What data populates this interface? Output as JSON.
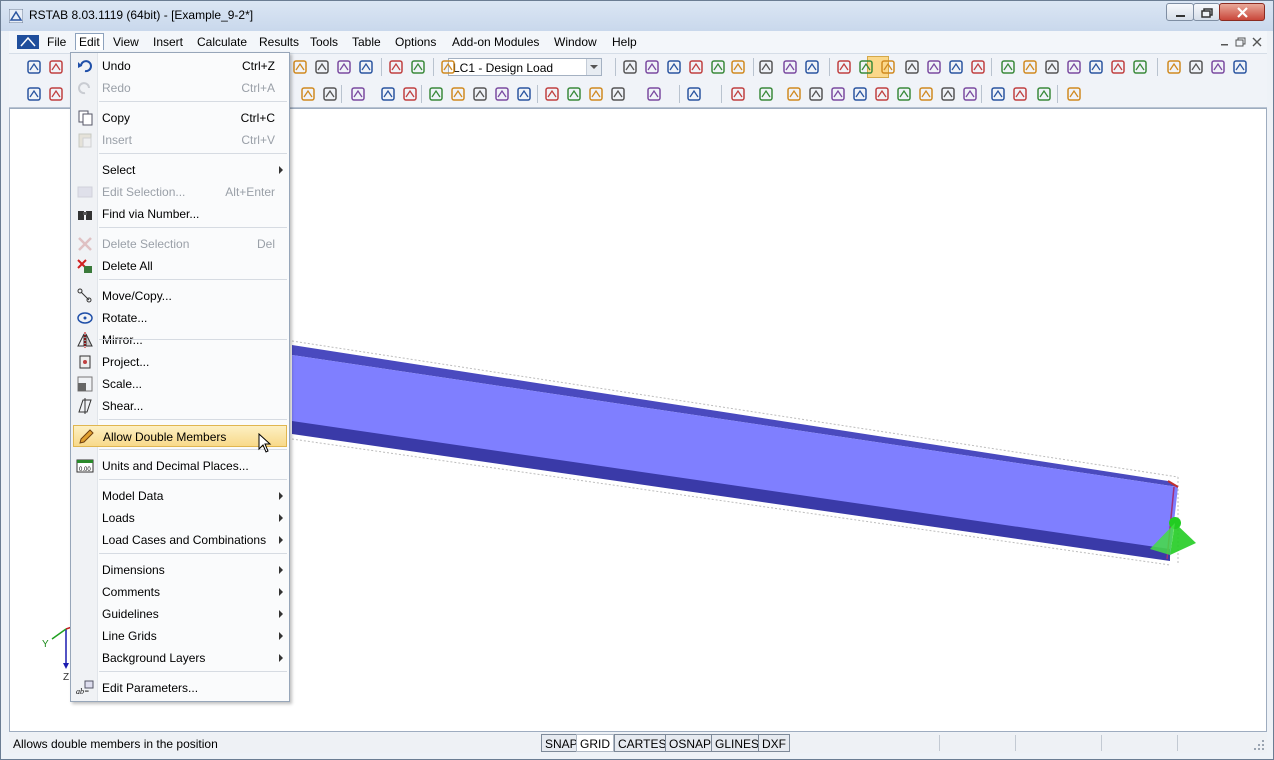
{
  "window": {
    "title": "RSTAB 8.03.1119 (64bit) - [Example_9-2*]"
  },
  "menubar": {
    "items": [
      "File",
      "Edit",
      "View",
      "Insert",
      "Calculate",
      "Results",
      "Tools",
      "Table",
      "Options",
      "Add-on Modules",
      "Window",
      "Help"
    ]
  },
  "toolbar": {
    "load_case": "LC1 - Design Load"
  },
  "edit_menu": {
    "items": [
      {
        "label": "Undo",
        "shortcut": "Ctrl+Z",
        "icon": "undo-icon"
      },
      {
        "label": "Redo",
        "shortcut": "Ctrl+A",
        "icon": "redo-icon"
      },
      {
        "label": "Copy",
        "shortcut": "Ctrl+C",
        "icon": "copy-icon"
      },
      {
        "label": "Insert",
        "shortcut": "Ctrl+V",
        "icon": "paste-icon"
      },
      {
        "label": "Select",
        "icon": "none"
      },
      {
        "label": "Edit Selection...",
        "shortcut": "Alt+Enter",
        "icon": "edit-selection-icon"
      },
      {
        "label": "Find via Number...",
        "icon": "binoculars-icon"
      },
      {
        "label": "Delete Selection",
        "shortcut": "Del",
        "icon": "delete-icon"
      },
      {
        "label": "Delete All",
        "icon": "delete-all-icon"
      },
      {
        "label": "Move/Copy...",
        "icon": "move-copy-icon"
      },
      {
        "label": "Rotate...",
        "icon": "rotate-icon"
      },
      {
        "label": "Mirror...",
        "icon": "mirror-icon"
      },
      {
        "label": "Project...",
        "icon": "project-icon"
      },
      {
        "label": "Scale...",
        "icon": "scale-icon"
      },
      {
        "label": "Shear...",
        "icon": "shear-icon"
      },
      {
        "label": "Allow Double Members",
        "icon": "pencil-icon"
      },
      {
        "label": "Units and Decimal Places...",
        "icon": "units-icon"
      },
      {
        "label": "Model Data",
        "icon": "none"
      },
      {
        "label": "Loads",
        "icon": "none"
      },
      {
        "label": "Load Cases and Combinations",
        "icon": "none"
      },
      {
        "label": "Dimensions",
        "icon": "none"
      },
      {
        "label": "Comments",
        "icon": "none"
      },
      {
        "label": "Guidelines",
        "icon": "none"
      },
      {
        "label": "Line Grids",
        "icon": "none"
      },
      {
        "label": "Background Layers",
        "icon": "none"
      },
      {
        "label": "Edit Parameters...",
        "icon": "parameters-icon"
      }
    ]
  },
  "axes": {
    "y": "Y",
    "z": "Z"
  },
  "status": {
    "text": "Allows double members in the position",
    "toggles": [
      "SNAP",
      "GRID",
      "CARTES",
      "OSNAP",
      "GLINES",
      "DXF"
    ]
  },
  "colors": {
    "beam": "#7f7fff",
    "beam_dark": "#3a3aa8",
    "support": "#22cc22",
    "highlight": "#f8d98a"
  }
}
